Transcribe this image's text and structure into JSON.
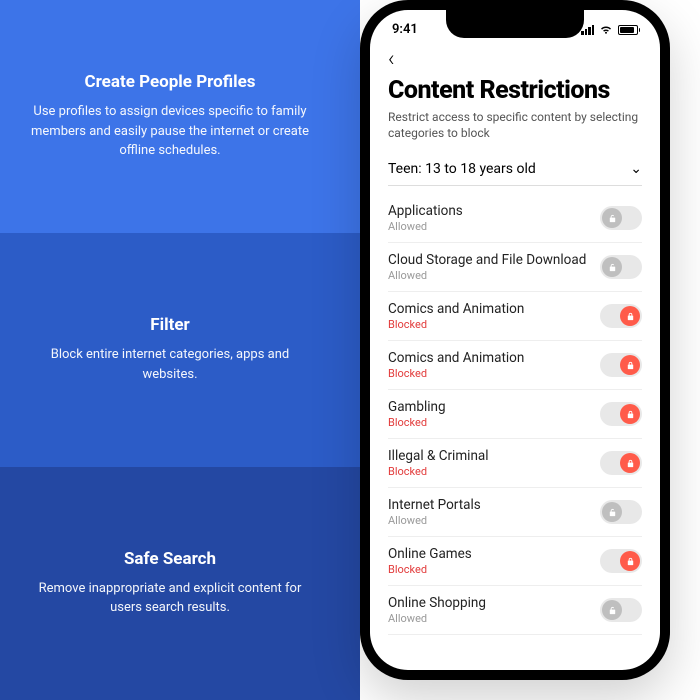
{
  "panels": [
    {
      "title": "Create People Profiles",
      "body": "Use profiles to assign devices specific to family members  and easily pause the internet or create offline schedules."
    },
    {
      "title": "Filter",
      "body": "Block entire internet categories, apps and websites."
    },
    {
      "title": "Safe Search",
      "body": "Remove inappropriate and explicit content for users search results."
    }
  ],
  "statusbar": {
    "time": "9:41"
  },
  "screen": {
    "title": "Content Restrictions",
    "subtitle": "Restrict access to specific content by selecting categories to block",
    "age_label": "Teen: 13 to 18 years old"
  },
  "items": [
    {
      "name": "Applications",
      "status": "Allowed",
      "blocked": false
    },
    {
      "name": "Cloud Storage and File Download",
      "status": "Allowed",
      "blocked": false
    },
    {
      "name": "Comics and Animation",
      "status": "Blocked",
      "blocked": true
    },
    {
      "name": "Comics and Animation",
      "status": "Blocked",
      "blocked": true
    },
    {
      "name": "Gambling",
      "status": "Blocked",
      "blocked": true
    },
    {
      "name": "Illegal & Criminal",
      "status": "Blocked",
      "blocked": true
    },
    {
      "name": "Internet Portals",
      "status": "Allowed",
      "blocked": false
    },
    {
      "name": "Online Games",
      "status": "Blocked",
      "blocked": true
    },
    {
      "name": "Online Shopping",
      "status": "Allowed",
      "blocked": false
    }
  ]
}
